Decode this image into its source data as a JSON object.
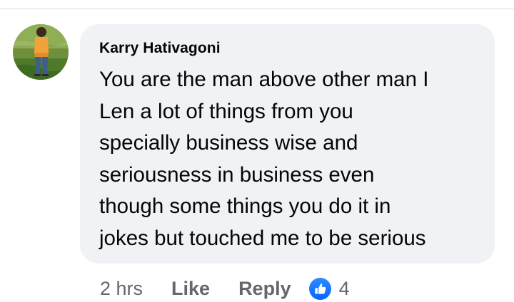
{
  "comment": {
    "author": "Karry Hativagoni",
    "text_lines": [
      "You are the man above other man I",
      "Len a lot of things from you",
      "specially business wise and",
      "seriousness in business even",
      "though some things you do it in",
      "jokes but touched me to be serious"
    ],
    "timestamp": "2 hrs",
    "like_label": "Like",
    "reply_label": "Reply",
    "reaction_icon": "like-thumbs-up-icon",
    "reaction_count": "4"
  },
  "colors": {
    "bubble_background": "#f0f2f5",
    "primary_text": "#050505",
    "secondary_text": "#65676b",
    "like_blue": "#0866ff",
    "divider": "#dadde1"
  }
}
